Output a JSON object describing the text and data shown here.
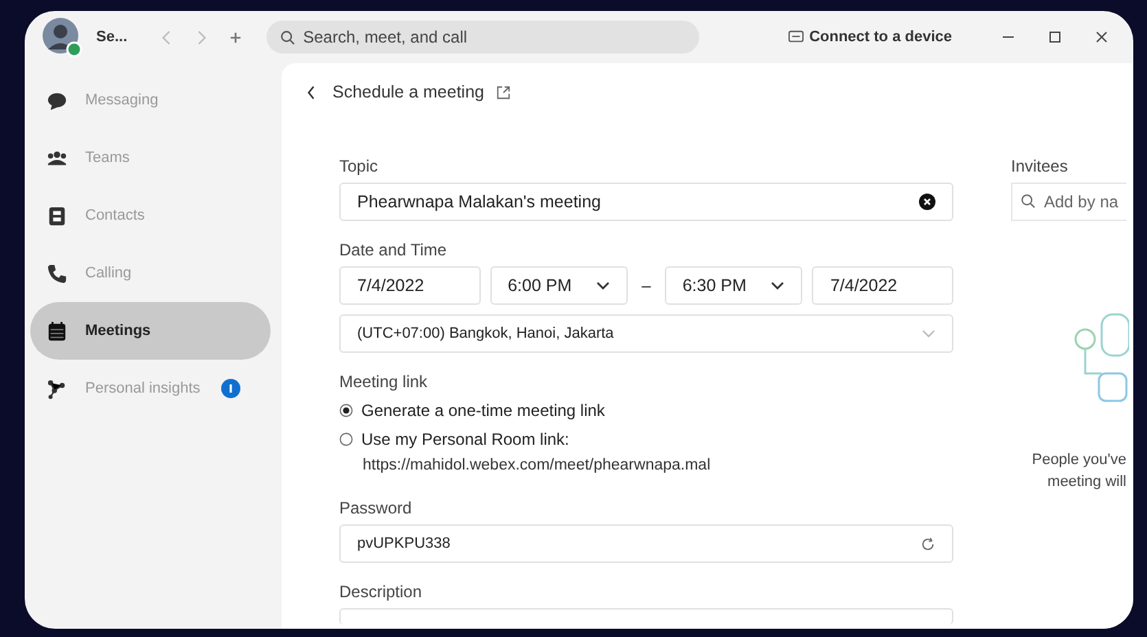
{
  "window": {
    "user_name": "Se...",
    "search": {
      "placeholder": "Search, meet, and call"
    },
    "connect_label": "Connect to a device"
  },
  "sidebar": {
    "items": [
      {
        "label": "Messaging",
        "kind": "chat",
        "selected": false,
        "badge": false
      },
      {
        "label": "Teams",
        "kind": "teams",
        "selected": false,
        "badge": false
      },
      {
        "label": "Contacts",
        "kind": "contacts",
        "selected": false,
        "badge": false
      },
      {
        "label": "Calling",
        "kind": "phone",
        "selected": false,
        "badge": false
      },
      {
        "label": "Meetings",
        "kind": "calendar",
        "selected": true,
        "badge": false
      },
      {
        "label": "Personal insights",
        "kind": "insights",
        "selected": false,
        "badge": true
      }
    ]
  },
  "page": {
    "title": "Schedule a meeting"
  },
  "form": {
    "topic": {
      "label": "Topic",
      "value": "Phearwnapa Malakan's meeting"
    },
    "date_time": {
      "label": "Date and Time",
      "start_date": "7/4/2022",
      "start_time": "6:00 PM",
      "separator": "–",
      "end_time": "6:30 PM",
      "end_date": "7/4/2022",
      "timezone": "(UTC+07:00) Bangkok, Hanoi, Jakarta"
    },
    "meeting_link": {
      "label": "Meeting link",
      "options": [
        {
          "label": "Generate a one-time meeting link",
          "selected": true
        },
        {
          "label": "Use my Personal Room link:",
          "selected": false,
          "url": "https://mahidol.webex.com/meet/phearwnapa.mal"
        }
      ]
    },
    "password": {
      "label": "Password",
      "value": "pvUPKPU338"
    },
    "description": {
      "label": "Description"
    }
  },
  "invitees": {
    "label": "Invitees",
    "search": {
      "placeholder": "Add by na"
    },
    "empty_text": [
      "People you've",
      "meeting will"
    ]
  }
}
